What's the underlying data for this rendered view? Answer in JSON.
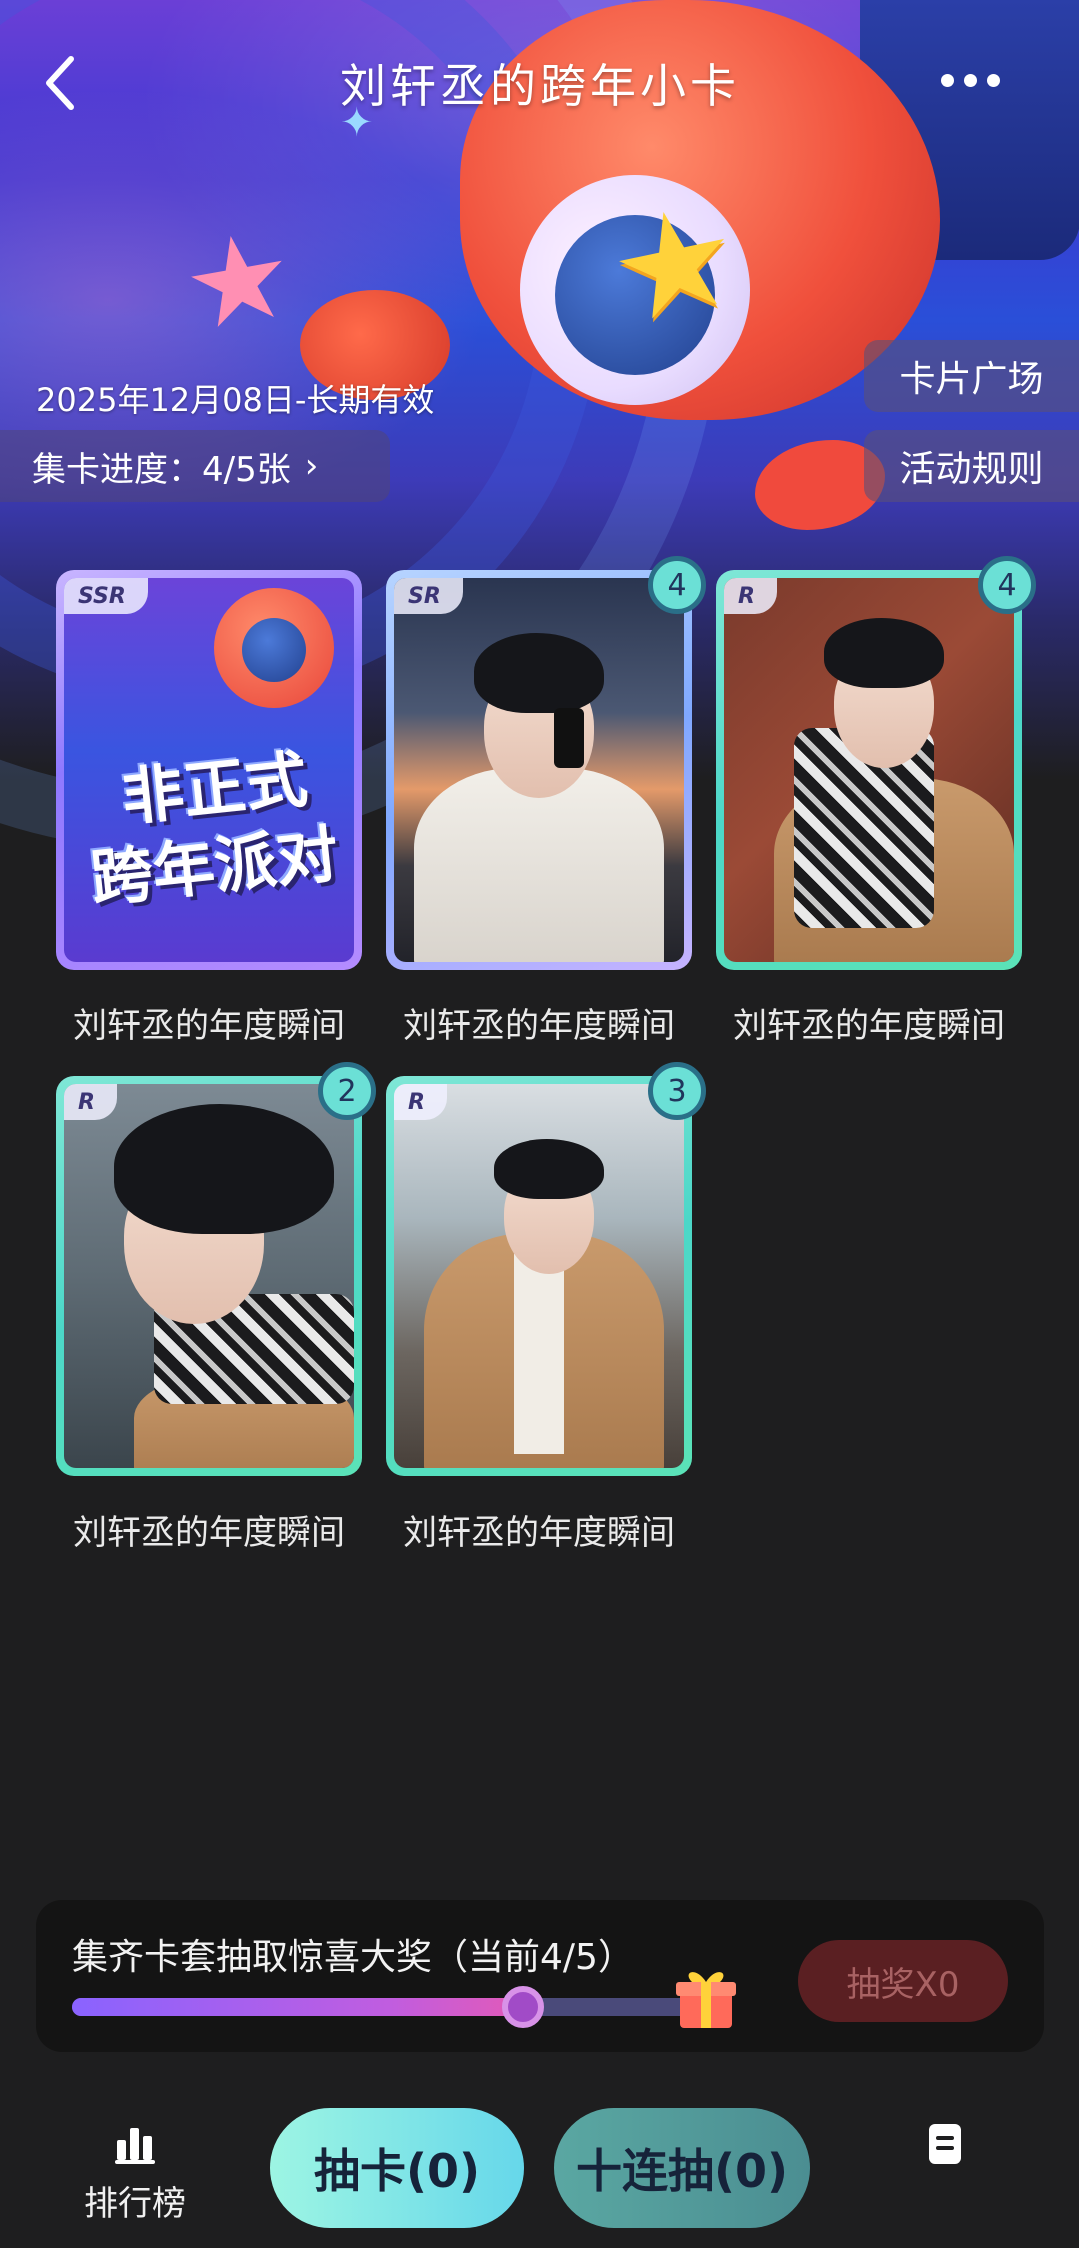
{
  "header": {
    "title": "刘轩丞的跨年小卡",
    "back_icon": "back-arrow-icon",
    "more_icon": "more-dots-icon"
  },
  "hero": {
    "validity": "2025年12月08日-长期有效",
    "progress_label": "集卡进度：4/5张",
    "progress_chevron": "›",
    "card_plaza": "卡片广场",
    "event_rules": "活动规则"
  },
  "cards": [
    {
      "tier": "SSR",
      "label": "刘轩丞的年度瞬间",
      "count": "",
      "art_line1": "非正式",
      "art_line2": "跨年派对"
    },
    {
      "tier": "SR",
      "label": "刘轩丞的年度瞬间",
      "count": "4"
    },
    {
      "tier": "R",
      "label": "刘轩丞的年度瞬间",
      "count": "4"
    },
    {
      "tier": "R",
      "label": "刘轩丞的年度瞬间",
      "count": "2"
    },
    {
      "tier": "R",
      "label": "刘轩丞的年度瞬间",
      "count": "3"
    }
  ],
  "prize": {
    "text": "集齐卡套抽取惊喜大奖（当前4/5）",
    "progress": 0.8,
    "draw_button": "抽奖X0",
    "gift_icon": "gift-icon"
  },
  "bottom_bar": {
    "rank_label": "排行榜",
    "rank_icon": "bar-chart-icon",
    "draw_label": "抽卡(0)",
    "ten_draw_label": "十连抽(0)",
    "list_icon": "document-icon"
  },
  "colors": {
    "background": "#1e1e1f",
    "draw_button_bg": "#9df5e3",
    "ten_draw_bg": "#5aa7a2",
    "disabled_prize_btn": "#5a1f22"
  }
}
